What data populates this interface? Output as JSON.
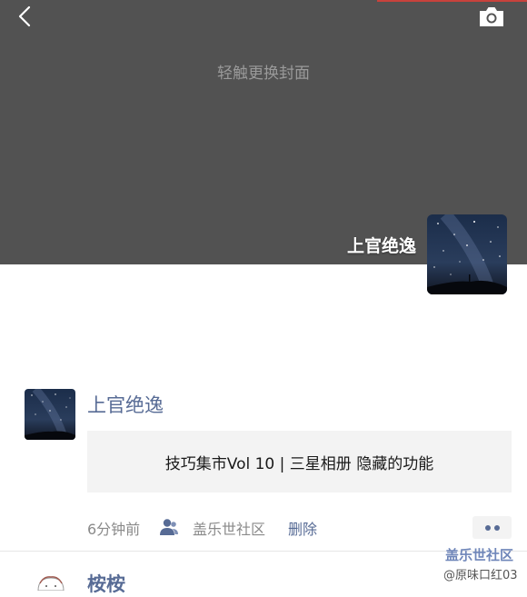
{
  "cover": {
    "hint": "轻触更换封面",
    "owner_name": "上官绝逸",
    "back_icon": "chevron-left-icon",
    "camera_icon": "camera-icon",
    "background_color": "#525252"
  },
  "post": {
    "author": "上官绝逸",
    "link_title": "技巧集市Vol 10 | 三星相册 隐藏的功能",
    "time": "6分钟前",
    "visibility_icon": "group-icon",
    "visibility": "盖乐世社区",
    "delete_label": "删除",
    "more_icon": "more-dots-icon",
    "name_color": "#576b95"
  },
  "next_post": {
    "author": "桉桉"
  },
  "watermark": {
    "title": "盖乐世社区",
    "subtitle": "@原味口红03"
  }
}
